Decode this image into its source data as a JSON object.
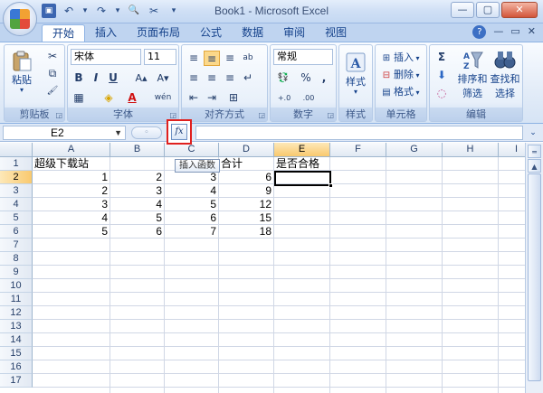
{
  "window": {
    "title": "Book1 - Microsoft Excel",
    "buttons": {
      "minimize": "—",
      "restore": "▢",
      "close": "✕"
    }
  },
  "qat": {
    "save": "▣",
    "undo": "↶",
    "undo_dd": "▾",
    "redo": "↷",
    "redo_dd": "▾",
    "print_preview": "🔍",
    "tools": "✂",
    "customize": "▾"
  },
  "tabs": [
    "开始",
    "插入",
    "页面布局",
    "公式",
    "数据",
    "审阅",
    "视图"
  ],
  "tab_right": {
    "help": "?",
    "minimize": "—",
    "restore": "▭",
    "close": "✕"
  },
  "ribbon": {
    "clipboard": {
      "label": "剪贴板",
      "paste": "粘贴",
      "paste_dd": "▾",
      "cut": "✂",
      "copy": "⧉",
      "format_painter": "🖌"
    },
    "font": {
      "label": "字体",
      "font_name": "宋体",
      "font_size": "11",
      "bold": "B",
      "italic": "I",
      "underline": "U",
      "grow": "A▴",
      "shrink": "A▾",
      "border": "▦",
      "fill": "◈",
      "color": "A",
      "phonetic": "wén"
    },
    "alignment": {
      "label": "对齐方式",
      "top": "≡",
      "middle": "≡",
      "bottom": "≡",
      "orient": "ab",
      "left": "≡",
      "center": "≡",
      "right": "≡",
      "wrap": "↵",
      "decrease": "⇤",
      "increase": "⇥",
      "merge": "⊞"
    },
    "number": {
      "label": "数字",
      "format": "常规",
      "currency": "💱",
      "percent": "%",
      "comma": ",",
      "inc_decimal": "+.0",
      "dec_decimal": ".00"
    },
    "styles": {
      "label": "样式",
      "button": "样式"
    },
    "cells": {
      "label": "单元格",
      "insert": "插入",
      "delete": "删除",
      "format": "格式"
    },
    "editing": {
      "label": "编辑",
      "sum": "Σ",
      "fill": "⬇",
      "clear": "◌",
      "sort_filter_1": "排序和",
      "sort_filter_2": "筛选",
      "find_select_1": "查找和",
      "find_select_2": "选择"
    }
  },
  "formula_bar": {
    "name_box": "E2",
    "fx": "fx",
    "formula": ""
  },
  "tooltip": "插入函数",
  "sheet": {
    "columns": [
      "A",
      "B",
      "C",
      "D",
      "E",
      "F",
      "G",
      "H",
      "I"
    ],
    "rows": [
      "1",
      "2",
      "3",
      "4",
      "5",
      "6",
      "7",
      "8",
      "9",
      "10",
      "11",
      "12",
      "13",
      "14",
      "15",
      "16",
      "17"
    ],
    "selected_cell": "E2",
    "header_row": {
      "A": "超级下载站",
      "D": "合计",
      "E": "是否合格"
    },
    "data": [
      {
        "B": "1",
        "C": "2",
        "D": "3",
        "E": "6"
      },
      {
        "B": "2",
        "C": "3",
        "D": "4",
        "E": "9"
      },
      {
        "B": "3",
        "C": "4",
        "D": "5",
        "E": "12"
      },
      {
        "B": "4",
        "C": "5",
        "D": "6",
        "E": "15"
      },
      {
        "B": "5",
        "C": "6",
        "D": "7",
        "E": "18"
      }
    ]
  }
}
